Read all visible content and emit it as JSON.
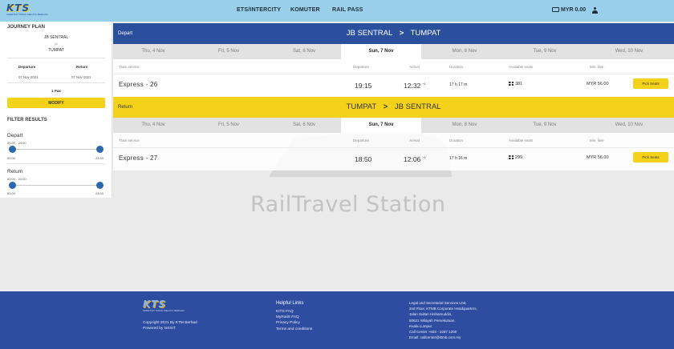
{
  "brand": {
    "logo_text": "KTS",
    "logo_tagline": "KERETAPI TANAH MELAYU BERHAD"
  },
  "nav": {
    "items": [
      "ETS/INTERCITY",
      "KOMUTER",
      "RAIL PASS"
    ],
    "wallet": "MYR 0.00",
    "wallet_icon": "wallet-icon",
    "user_icon": "user-icon"
  },
  "journey": {
    "title": "JOURNEY PLAN",
    "from": "JB SENTRAL",
    "to_word": "to",
    "to": "TUMPAT",
    "departure_label": "Departure",
    "departure_date": "07 Nov 2021",
    "return_label": "Return",
    "return_date": "07 Nov 2021",
    "pax": "1 Pax",
    "modify_label": "MODIFY"
  },
  "filters": {
    "title": "FILTER RESULTS",
    "depart_label": "Depart",
    "depart_range": "00:00 - 24:00",
    "return_label": "Return",
    "return_range": "00:00 - 24:00",
    "min": "00:00",
    "max": "24:00"
  },
  "columns": {
    "service": "Train service",
    "departure": "Departure",
    "arrival": "Arrival",
    "duration": "Duration",
    "seats": "Available seats",
    "fare": "Min. fare"
  },
  "depart_section": {
    "label": "Depart",
    "from": "JB SENTRAL",
    "arrow": ">",
    "to": "TUMPAT",
    "dates": [
      "Thu, 4 Nov",
      "Fri, 5 Nov",
      "Sat, 6 Nov",
      "Sun, 7 Nov",
      "Mon, 8 Nov",
      "Tue, 9 Nov",
      "Wed, 10 Nov"
    ],
    "train": {
      "service": "Express - 26",
      "departure": "19:15",
      "arrival": "12:32",
      "arrival_offset": "+1",
      "duration": "17 h  17 m",
      "seats": "381",
      "fare": "MYR 56.00",
      "button": "Pick Seats"
    }
  },
  "return_section": {
    "label": "Return",
    "from": "TUMPAT",
    "arrow": ">",
    "to": "JB SENTRAL",
    "dates": [
      "Thu, 4 Nov",
      "Fri, 5 Nov",
      "Sat, 6 Nov",
      "Sun, 7 Nov",
      "Mon, 8 Nov",
      "Tue, 9 Nov",
      "Wed, 10 Nov"
    ],
    "train": {
      "service": "Express - 27",
      "departure": "18:50",
      "arrival": "12:06",
      "arrival_offset": "+1",
      "duration": "17 h  16 m",
      "seats": "299",
      "fare": "MYR 56.00",
      "button": "Pick Seats"
    }
  },
  "watermark": "RailTravel Station",
  "footer": {
    "logo_text": "KTS",
    "logo_tagline": "KERETAPI TANAH MELAYU BERHAD",
    "copyright": "Copyright 2021 By KTM Berhad",
    "powered": "Powered by NSSIT",
    "links_title": "Helpful Links",
    "links": [
      "KITS FAQ",
      "MyRailS FAQ",
      "Privacy Policy",
      "Terms and conditions"
    ],
    "address": [
      "Legal and Secretarial Services Unit,",
      "2nd Floor, KTMB Corporate Headquarters,",
      "Jalan Sultan Hishamuddin,",
      "50621 Wilayah Persekutuan,",
      "Kuala Lumpur.",
      "Call Center +603 - 2267 1200",
      "Email: callcenter@ktmb.com.my"
    ]
  },
  "colors": {
    "blue": "#2a4f9c",
    "yellow": "#f5d21a",
    "topbar": "#99cfe8",
    "footer": "#2e4da0"
  }
}
